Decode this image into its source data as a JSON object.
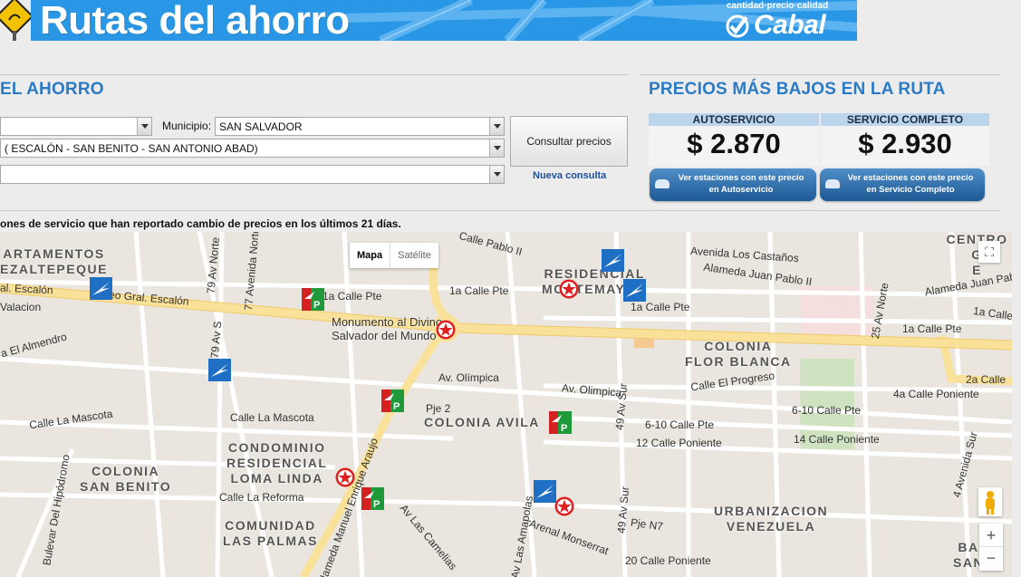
{
  "banner": {
    "title": "Rutas del ahorro",
    "tagline": "cantidad·precio·calidad",
    "brand": "Cabal"
  },
  "form": {
    "section_title": "EL AHORRO",
    "municipio_label": "Municipio:",
    "municipio_value": "SAN SALVADOR",
    "departamento_value": "",
    "zona_value": "( ESCALÓN - SAN BENITO - SAN ANTONIO ABAD)",
    "extra_value": "",
    "consult_button": "Consultar precios",
    "new_query_link": "Nueva consulta",
    "note": "ones de servicio que han reportado cambio de precios en los últimos 21 días."
  },
  "prices": {
    "section_title": "PRECIOS MÁS BAJOS EN LA RUTA",
    "autoservicio": {
      "label": "AUTOSERVICIO",
      "value": "$ 2.870",
      "button": "Ver estaciones con este precio\nen Autoservicio"
    },
    "completo": {
      "label": "SERVICIO COMPLETO",
      "value": "$ 2.930",
      "button": "Ver estaciones con este precio\nen Servicio Completo"
    }
  },
  "map": {
    "type_options": [
      "Mapa",
      "Satélite"
    ],
    "selected_type": "Mapa",
    "zoom_in": "+",
    "zoom_out": "−",
    "areas": [
      "ARTAMENTOS\nEZALTEPEQUE",
      "RESIDENCIAL\nMONTEMAYOR",
      "COLONIA\nFLOR BLANCA",
      "COLONIA AVILA",
      "CONDOMINIO\nRESIDENCIAL\nLOMA LINDA",
      "COLONIA\nSAN BENITO",
      "COMUNIDAD\nLAS PALMAS",
      "URBANIZACION\nVENEZUELA",
      "CENTRO G\nE",
      "BA\nSAN"
    ],
    "streets": [
      "eo Gral. Escalón",
      "al. Escalón",
      "Valacion",
      "a El Almendro",
      "1a Calle Pte",
      "1a Calle Pte",
      "1a Calle Pte",
      "Avenida Los Castaños",
      "Alameda Juan Pablo II",
      "Alameda Juan Pablo",
      "Calle Pablo II",
      "25 Av Norte",
      "1a Calle Pte",
      "1a Calle Pt",
      "Av. Olímpica",
      "Av. Olimpica",
      "Calle El Progreso",
      "4a Calle Poniente",
      "2a Calle",
      "Calle La Mascota",
      "Calle La Mascota",
      "Pje 2",
      "6-10 Calle Pte",
      "6-10 Calle Pte",
      "12 Calle Poniente",
      "14 Calle Poniente",
      "Calle La Reforma",
      "Alameda Manuel Enrique Araujo",
      "Av Las Camelias",
      "Av Las Amapolas",
      "Arenal Monserrat",
      "49 Av Sur",
      "Pje N7",
      "20 Calle Poniente",
      "79 Av Norte",
      "77 Avenida Norte",
      "79 Av S",
      "Bulevar Del Hipódromo",
      "4 Avenida Sur",
      "49 Av Sur"
    ],
    "landmarks": [
      "Monumento al Divino\nSalvador del Mundo"
    ]
  }
}
